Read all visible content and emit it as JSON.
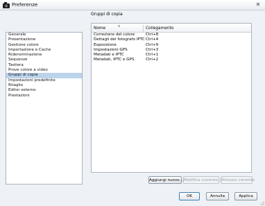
{
  "window": {
    "title": "Preferenze",
    "close_symbol": "✕"
  },
  "sidebar": {
    "items": [
      {
        "label": "Generale"
      },
      {
        "label": "Presentazione"
      },
      {
        "label": "Gestione colore"
      },
      {
        "label": "Importazione e Cache"
      },
      {
        "label": "Ridenominazione"
      },
      {
        "label": "Sequenze"
      },
      {
        "label": "Tastiera"
      },
      {
        "label": "Prove colore a video"
      },
      {
        "label": "Gruppi di copia",
        "selected": true
      },
      {
        "label": "Impostazioni predefinite"
      },
      {
        "label": "Ritaglio"
      },
      {
        "label": "Editor esterno"
      },
      {
        "label": "Prestazioni"
      }
    ]
  },
  "panel": {
    "title": "Gruppi di copia",
    "columns": [
      "Nome",
      "Collegamento"
    ],
    "rows": [
      [
        "Correzione del colore",
        "Ctrl+8"
      ],
      [
        "Dettagli del fotografo IPTC",
        "Ctrl+4"
      ],
      [
        "Esposizione",
        "Ctrl+9"
      ],
      [
        "Impostazioni GPS",
        "Ctrl+3"
      ],
      [
        "Metadati e IPTC",
        "Ctrl+1"
      ],
      [
        "Metadati, IPTC e GPS",
        "Ctrl+2"
      ]
    ],
    "buttons": {
      "add": "Aggiungi nuovo...",
      "edit": "Modifica corrente...",
      "remove": "Rimuovi corrente"
    }
  },
  "footer": {
    "ok": "OK",
    "cancel": "Annulla",
    "apply": "Applica"
  },
  "colors": {
    "selection": "#bcd3ec",
    "window_bg": "#eef1f5"
  }
}
